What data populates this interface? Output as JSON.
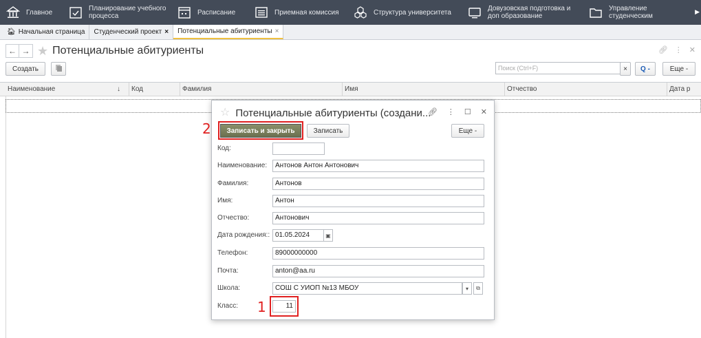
{
  "topnav": {
    "items": [
      {
        "icon": "home-icon",
        "label": "Главное"
      },
      {
        "icon": "calendar-check-icon",
        "label": "Планирование учебного процесса"
      },
      {
        "icon": "calendar-icon",
        "label": "Расписание"
      },
      {
        "icon": "list-icon",
        "label": "Приемная комиссия"
      },
      {
        "icon": "structure-icon",
        "label": "Структура университета"
      },
      {
        "icon": "monitor-icon",
        "label": "Довузовская подготовка и доп образование"
      },
      {
        "icon": "folder-icon",
        "label": "Управление студенческим составом"
      }
    ]
  },
  "tabs": [
    {
      "label": "Начальная страница",
      "home": true
    },
    {
      "label": "Студенческий проект",
      "close": "×"
    },
    {
      "label": "Потенциальные абитуриенты",
      "close": "×",
      "active": true
    }
  ],
  "page": {
    "title": "Потенциальные абитуриенты",
    "create_label": "Создать",
    "search_placeholder": "Поиск (Ctrl+F)",
    "more_label": "Еще -",
    "clear": "×",
    "search_btn": "Q -"
  },
  "grid": {
    "columns": [
      "Наименование",
      "Код",
      "Фамилия",
      "Имя",
      "Отчество",
      "Дата р"
    ],
    "sort_indicator": "↓"
  },
  "modal": {
    "title": "Потенциальные абитуриенты (создани...",
    "save_close_label": "Записать и закрыть",
    "save_label": "Записать",
    "more_label": "Еще -",
    "fields": {
      "code": {
        "label": "Код:",
        "value": ""
      },
      "name": {
        "label": "Наименование:",
        "value": "Антонов Антон Антонович"
      },
      "last_name": {
        "label": "Фамилия:",
        "value": "Антонов"
      },
      "first_name": {
        "label": "Имя:",
        "value": "Антон"
      },
      "middle_name": {
        "label": "Отчество:",
        "value": "Антонович"
      },
      "birth_date": {
        "label": "Дата рождения::",
        "value": "01.05.2024"
      },
      "phone": {
        "label": "Телефон:",
        "value": "89000000000"
      },
      "email": {
        "label": "Почта:",
        "value": "anton@aa.ru"
      },
      "school": {
        "label": "Школа:",
        "value": "СОШ С УИОП №13 МБОУ"
      },
      "grade": {
        "label": "Класс:",
        "value": "11"
      }
    }
  },
  "annotations": {
    "step1": "1",
    "step2": "2"
  },
  "colors": {
    "topbar": "#434b58",
    "highlight": "#e02020",
    "primary_button": "#6b7050"
  }
}
